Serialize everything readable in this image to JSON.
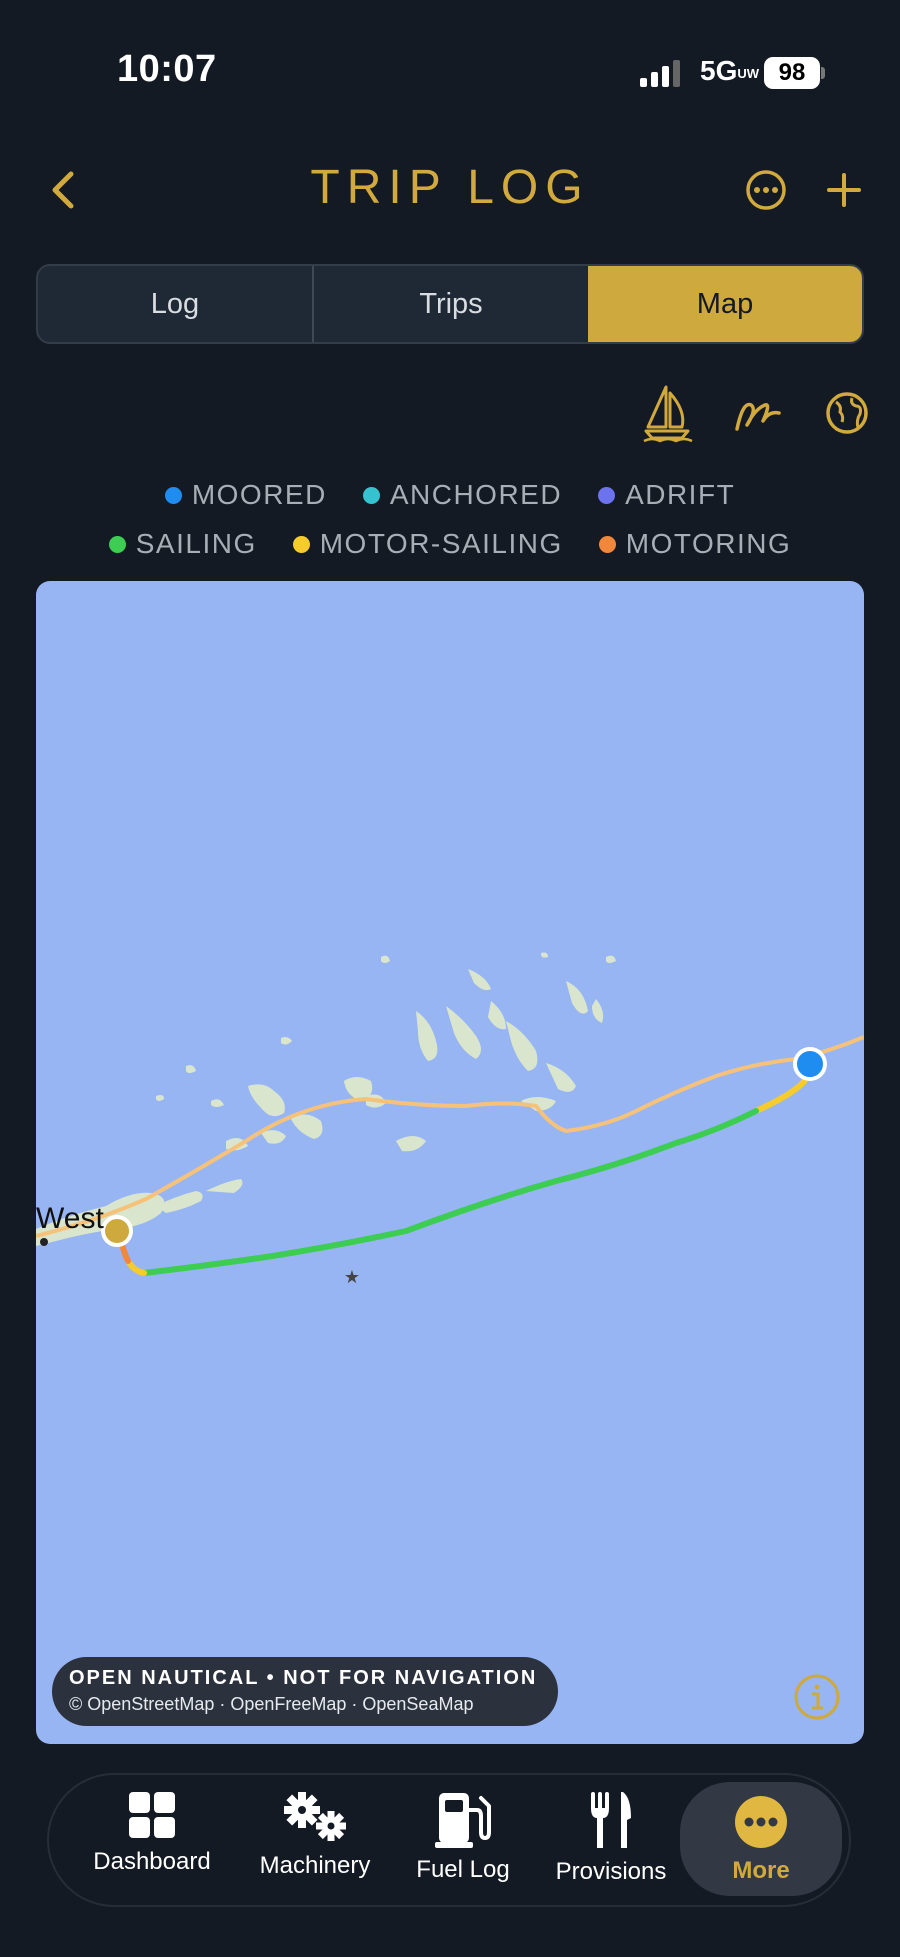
{
  "status_bar": {
    "time": "10:07",
    "network": "5G",
    "network_suffix": "UW",
    "battery": "98"
  },
  "header": {
    "title": "TRIP LOG",
    "back_icon": "chevron-left-icon",
    "more_icon": "ellipsis-circle-icon",
    "add_icon": "plus-icon"
  },
  "segments": [
    {
      "label": "Log",
      "active": false
    },
    {
      "label": "Trips",
      "active": false
    },
    {
      "label": "Map",
      "active": true
    }
  ],
  "tools": [
    "sailboat-icon",
    "track-line-icon",
    "globe-icon"
  ],
  "legend": [
    {
      "label": "MOORED",
      "color": "#1f8cf0"
    },
    {
      "label": "ANCHORED",
      "color": "#34c3cf"
    },
    {
      "label": "ADRIFT",
      "color": "#6d73ee"
    },
    {
      "label": "SAILING",
      "color": "#3ccd52"
    },
    {
      "label": "MOTOR-SAILING",
      "color": "#f5cc2c"
    },
    {
      "label": "MOTORING",
      "color": "#f1873a"
    }
  ],
  "map": {
    "place_label": "West",
    "attribution_title": "OPEN NAUTICAL • NOT FOR NAVIGATION",
    "attribution_sources": "© OpenStreetMap · OpenFreeMap · OpenSeaMap",
    "watermark": "maplibre",
    "colors": {
      "water": "#98b5f3",
      "land": "#d9e6cd",
      "road": "#f6c27a",
      "route_sailing": "#3ccd52",
      "start_marker": "#cea93d",
      "end_marker": "#1f8cf0"
    }
  },
  "tabbar": [
    {
      "label": "Dashboard",
      "icon": "grid-icon",
      "active": false
    },
    {
      "label": "Machinery",
      "icon": "gears-icon",
      "active": false
    },
    {
      "label": "Fuel Log",
      "icon": "fuel-pump-icon",
      "active": false
    },
    {
      "label": "Provisions",
      "icon": "fork-knife-icon",
      "active": false
    },
    {
      "label": "More",
      "icon": "ellipsis-circle-icon",
      "active": true
    }
  ]
}
